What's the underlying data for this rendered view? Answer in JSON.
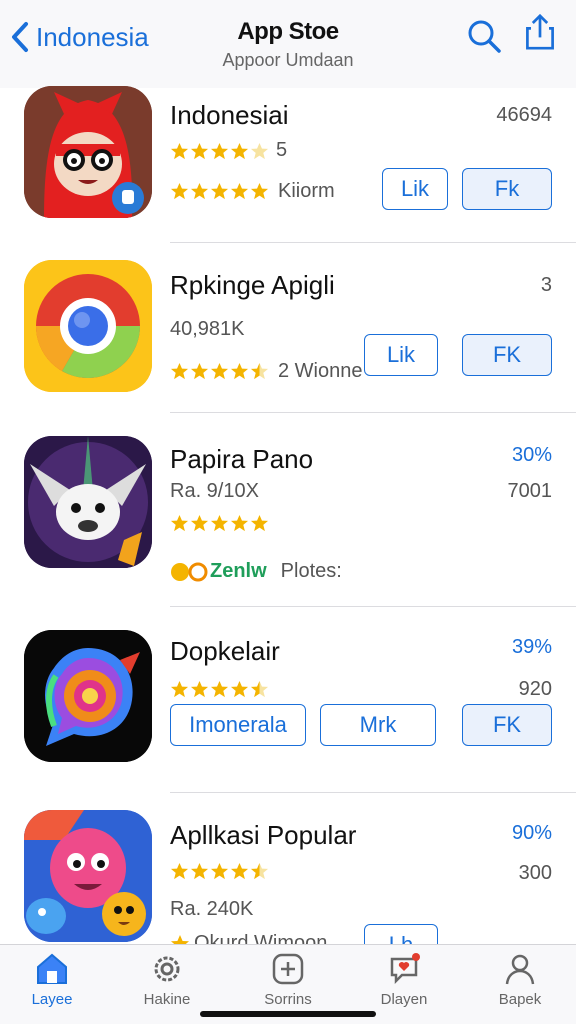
{
  "header": {
    "back_label": "Indonesia",
    "title": "App Stoe",
    "subtitle": "Appoor Umdaan"
  },
  "apps": [
    {
      "name": "Indonesiai",
      "rating_count": "5",
      "stars_row1": 4,
      "sub_label": "Kiiorm",
      "right_top": "46694",
      "buttons": [
        "Lik",
        "Fk"
      ]
    },
    {
      "name": "Rpkinge Apigli",
      "meta": "40,981K",
      "stars": 4.5,
      "sub_label": "2 Wionne",
      "right_top": "3",
      "buttons": [
        "Lik",
        "FK"
      ]
    },
    {
      "name": "Papira Pano",
      "meta": "Ra. 9/10X",
      "stars": 5,
      "sub_label": "Zenlw",
      "sub_label2": "Plotes:",
      "right_top": "30%",
      "right_mid": "7001"
    },
    {
      "name": "Dopkelair",
      "stars": 4.5,
      "right_top": "39%",
      "right_mid": "920",
      "buttons": [
        "Imonerala",
        "Mrk",
        "FK"
      ]
    },
    {
      "name": "Apllkasi Popular",
      "stars": 4.5,
      "meta": "Ra. 240K",
      "sub_label": "Okurd Wimoon",
      "right_top": "90%",
      "right_mid": "300",
      "buttons": [
        "Lh"
      ]
    }
  ],
  "tabs": [
    {
      "label": "Layee",
      "icon": "home-icon"
    },
    {
      "label": "Hakine",
      "icon": "gear-icon"
    },
    {
      "label": "Sorrins",
      "icon": "add-icon"
    },
    {
      "label": "Dlayen",
      "icon": "chat-heart-icon"
    },
    {
      "label": "Bapek",
      "icon": "person-icon"
    }
  ],
  "colors": {
    "accent": "#1a6fd9",
    "star": "#f4b400"
  }
}
